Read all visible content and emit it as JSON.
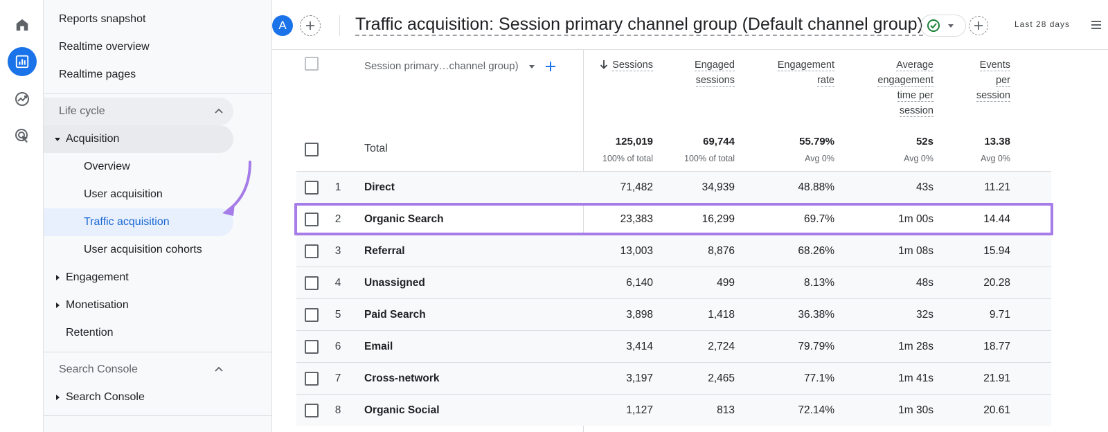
{
  "rail": {
    "icons": [
      "home-icon",
      "reports-icon",
      "explore-icon",
      "advertising-icon"
    ]
  },
  "sidebar": {
    "top_items": [
      "Reports snapshot",
      "Realtime overview",
      "Realtime pages"
    ],
    "lifecycle": {
      "label": "Life cycle",
      "acquisition": {
        "label": "Acquisition",
        "items": [
          "Overview",
          "User acquisition",
          "Traffic acquisition",
          "User acquisition cohorts"
        ],
        "selected": "Traffic acquisition"
      },
      "others": [
        "Engagement",
        "Monetisation",
        "Retention"
      ]
    },
    "search_console": {
      "label": "Search Console",
      "child": "Search Console"
    }
  },
  "header": {
    "avatar": "A",
    "title": "Traffic acquisition: Session primary channel group (Default channel group)",
    "date_range": "Last 28 days"
  },
  "table": {
    "dimension": "Session primary…channel group)",
    "total_label": "Total",
    "columns": [
      {
        "lines": [
          "Sessions"
        ],
        "sorted": true
      },
      {
        "lines": [
          "Engaged",
          "sessions"
        ]
      },
      {
        "lines": [
          "Engagement",
          "rate"
        ]
      },
      {
        "lines": [
          "Average",
          "engagement",
          "time per",
          "session"
        ]
      },
      {
        "lines": [
          "Events",
          "per",
          "session"
        ]
      }
    ],
    "totals": [
      {
        "value": "125,019",
        "sub": "100% of total"
      },
      {
        "value": "69,744",
        "sub": "100% of total"
      },
      {
        "value": "55.79%",
        "sub": "Avg 0%"
      },
      {
        "value": "52s",
        "sub": "Avg 0%"
      },
      {
        "value": "13.38",
        "sub": "Avg 0%"
      }
    ],
    "rows": [
      {
        "index": "1",
        "channel": "Direct",
        "values": [
          "71,482",
          "34,939",
          "48.88%",
          "43s",
          "11.21"
        ]
      },
      {
        "index": "2",
        "channel": "Organic Search",
        "values": [
          "23,383",
          "16,299",
          "69.7%",
          "1m 00s",
          "14.44"
        ]
      },
      {
        "index": "3",
        "channel": "Referral",
        "values": [
          "13,003",
          "8,876",
          "68.26%",
          "1m 08s",
          "15.94"
        ]
      },
      {
        "index": "4",
        "channel": "Unassigned",
        "values": [
          "6,140",
          "499",
          "8.13%",
          "48s",
          "20.28"
        ]
      },
      {
        "index": "5",
        "channel": "Paid Search",
        "values": [
          "3,898",
          "1,418",
          "36.38%",
          "32s",
          "9.71"
        ]
      },
      {
        "index": "6",
        "channel": "Email",
        "values": [
          "3,414",
          "2,724",
          "79.79%",
          "1m 28s",
          "18.77"
        ]
      },
      {
        "index": "7",
        "channel": "Cross-network",
        "values": [
          "3,197",
          "2,465",
          "77.1%",
          "1m 41s",
          "21.91"
        ]
      },
      {
        "index": "8",
        "channel": "Organic Social",
        "values": [
          "1,127",
          "813",
          "72.14%",
          "1m 30s",
          "20.61"
        ]
      }
    ]
  },
  "colors": {
    "accent": "#1a73e8",
    "highlight": "#a57ce8"
  }
}
